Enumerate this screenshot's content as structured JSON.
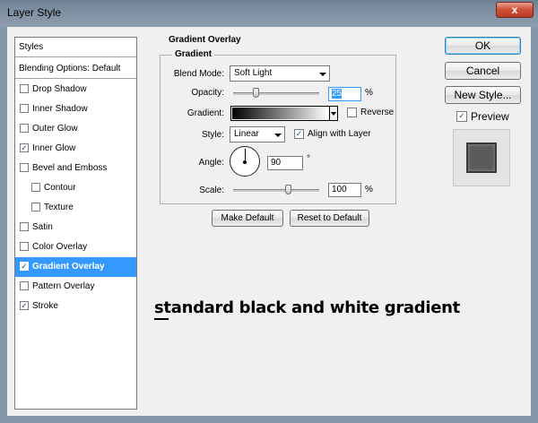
{
  "window": {
    "title": "Layer Style",
    "close_glyph": "x"
  },
  "styles_panel": {
    "header": "Styles",
    "blending_label": "Blending Options: Default",
    "items": [
      {
        "label": "Drop Shadow",
        "checked": false,
        "selected": false,
        "indent": false
      },
      {
        "label": "Inner Shadow",
        "checked": false,
        "selected": false,
        "indent": false
      },
      {
        "label": "Outer Glow",
        "checked": false,
        "selected": false,
        "indent": false
      },
      {
        "label": "Inner Glow",
        "checked": true,
        "selected": false,
        "indent": false
      },
      {
        "label": "Bevel and Emboss",
        "checked": false,
        "selected": false,
        "indent": false
      },
      {
        "label": "Contour",
        "checked": false,
        "selected": false,
        "indent": true
      },
      {
        "label": "Texture",
        "checked": false,
        "selected": false,
        "indent": true
      },
      {
        "label": "Satin",
        "checked": false,
        "selected": false,
        "indent": false
      },
      {
        "label": "Color Overlay",
        "checked": false,
        "selected": false,
        "indent": false
      },
      {
        "label": "Gradient Overlay",
        "checked": true,
        "selected": true,
        "indent": false
      },
      {
        "label": "Pattern Overlay",
        "checked": false,
        "selected": false,
        "indent": false
      },
      {
        "label": "Stroke",
        "checked": true,
        "selected": false,
        "indent": false
      }
    ]
  },
  "gradient_overlay": {
    "section_title": "Gradient Overlay",
    "group_title": "Gradient",
    "blend_mode": {
      "label": "Blend Mode:",
      "value": "Soft Light"
    },
    "opacity": {
      "label": "Opacity:",
      "value": "25",
      "unit": "%",
      "percent": 25
    },
    "gradient": {
      "label": "Gradient:",
      "start_color": "#000000",
      "end_color": "#ffffff"
    },
    "reverse": {
      "label": "Reverse",
      "checked": false
    },
    "style": {
      "label": "Style:",
      "value": "Linear"
    },
    "align_with_layer": {
      "label": "Align with Layer",
      "checked": true
    },
    "angle": {
      "label": "Angle:",
      "value": "90",
      "unit": "°",
      "degrees": 90
    },
    "scale": {
      "label": "Scale:",
      "value": "100",
      "unit": "%",
      "percent": 100
    },
    "make_default_label": "Make Default",
    "reset_default_label": "Reset to Default"
  },
  "dialog_buttons": {
    "ok": "OK",
    "cancel": "Cancel",
    "new_style": "New Style..."
  },
  "preview": {
    "label": "Preview",
    "checked": true
  },
  "annotation": "standard black and white gradient",
  "check_glyph": "✓",
  "colors": {
    "selection": "#3399ff",
    "title_bar": "#7f90a2"
  }
}
